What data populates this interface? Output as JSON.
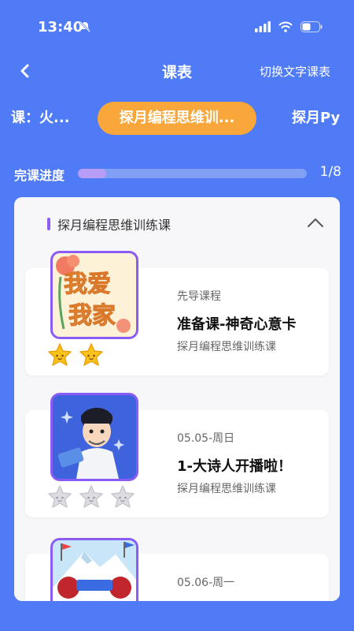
{
  "status": {
    "time": "13:40",
    "mute_icon": "bell-slash-icon",
    "signal_icon": "signal-icon",
    "wifi_icon": "wifi-icon",
    "battery_icon": "battery-icon"
  },
  "nav": {
    "title": "课表",
    "switch_label": "切换文字课表",
    "back_icon": "chevron-left-icon"
  },
  "tabs": [
    {
      "label": "课：火..."
    },
    {
      "label": "探月编程思维训...",
      "active": true
    },
    {
      "label": "探月Py"
    }
  ],
  "progress": {
    "label": "完课进度",
    "count": "1/8",
    "fraction": 0.125
  },
  "card": {
    "title": "探月编程思维训练课",
    "collapse_icon": "chevron-up-icon",
    "lessons": [
      {
        "meta": "先导课程",
        "title": "准备课-神奇心意卡",
        "subtitle": "探月编程思维训练课",
        "stars_earned": 2,
        "stars_total": 2,
        "thumb_text": [
          "我爱",
          "我家"
        ]
      },
      {
        "meta": "05.05-周日",
        "title": "1-大诗人开播啦！",
        "subtitle": "探月编程思维训练课",
        "stars_earned": 0,
        "stars_total": 3
      },
      {
        "meta": "05.06-周一",
        "title": "",
        "subtitle": ""
      }
    ]
  },
  "colors": {
    "background": "#4f7cf6",
    "accent_orange": "#f9a63a",
    "accent_purple": "#8a5cf5",
    "star_gold": "#f8c21d",
    "star_grey": "#d8d8de"
  }
}
